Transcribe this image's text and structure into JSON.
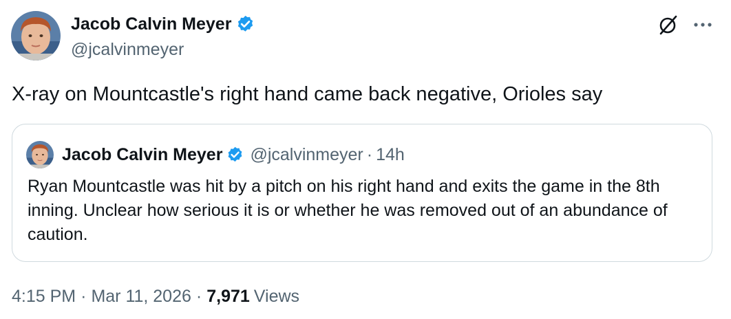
{
  "tweet": {
    "author_name": "Jacob Calvin Meyer",
    "author_handle": "@jcalvinmeyer",
    "text": "X-ray on Mountcastle's right hand came back negative, Orioles say",
    "time": "4:15 PM",
    "date": "Mar 11, 2026",
    "views_count": "7,971",
    "views_label": "Views"
  },
  "quoted": {
    "author_name": "Jacob Calvin Meyer",
    "author_handle": "@jcalvinmeyer",
    "time_ago": "14h",
    "text": "Ryan Mountcastle was hit by a pitch on his right hand and exits the game in the 8th inning. Unclear how serious it is or whether he was removed out of an abundance of caution."
  },
  "icons": [
    "avatar",
    "verified-badge-icon",
    "grok-icon",
    "more-icon"
  ],
  "colors": {
    "text_primary": "#0f1419",
    "text_secondary": "#536471",
    "verified_blue": "#1d9bf0",
    "border": "#cfd9de"
  }
}
